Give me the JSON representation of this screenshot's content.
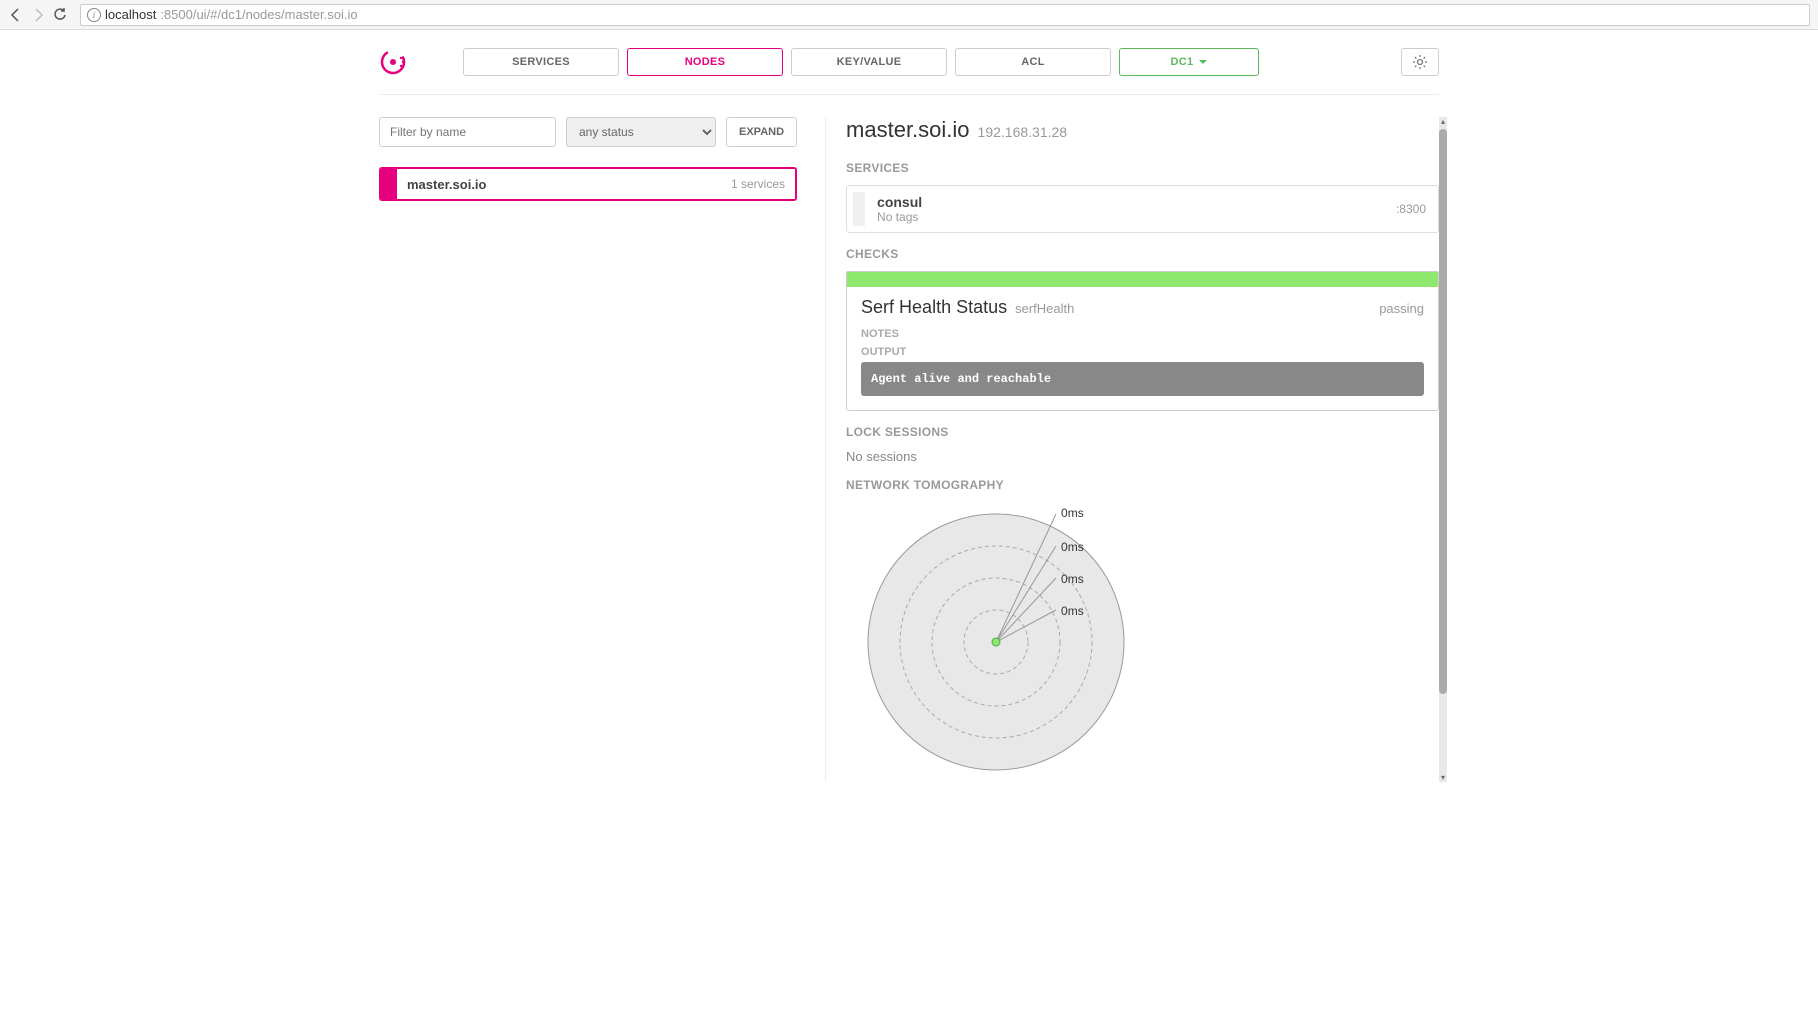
{
  "browser": {
    "url_host": "localhost",
    "url_rest": ":8500/ui/#/dc1/nodes/master.soi.io"
  },
  "nav": {
    "services": "SERVICES",
    "nodes": "NODES",
    "kv": "KEY/VALUE",
    "acl": "ACL",
    "dc": "DC1"
  },
  "filter": {
    "placeholder": "Filter by name",
    "status": "any status",
    "expand": "EXPAND"
  },
  "node_list": {
    "items": [
      {
        "name": "master.soi.io",
        "count": "1 services"
      }
    ]
  },
  "detail": {
    "title": "master.soi.io",
    "ip": "192.168.31.28",
    "sections": {
      "services": "SERVICES",
      "checks": "CHECKS",
      "lock_sessions": "LOCK SESSIONS",
      "tomography": "NETWORK TOMOGRAPHY"
    },
    "services": [
      {
        "name": "consul",
        "tags": "No tags",
        "port": ":8300"
      }
    ],
    "checks": [
      {
        "title": "Serf Health Status",
        "id": "serfHealth",
        "status": "passing",
        "notes_label": "NOTES",
        "output_label": "OUTPUT",
        "output": "Agent alive and reachable"
      }
    ],
    "no_sessions": "No sessions",
    "tomography_labels": [
      "0ms",
      "0ms",
      "0ms",
      "0ms"
    ]
  },
  "chart_data": {
    "type": "other",
    "description": "radial network tomography",
    "rings": 4,
    "ring_labels": [
      "0ms",
      "0ms",
      "0ms",
      "0ms"
    ],
    "center_node": "self",
    "points": []
  }
}
